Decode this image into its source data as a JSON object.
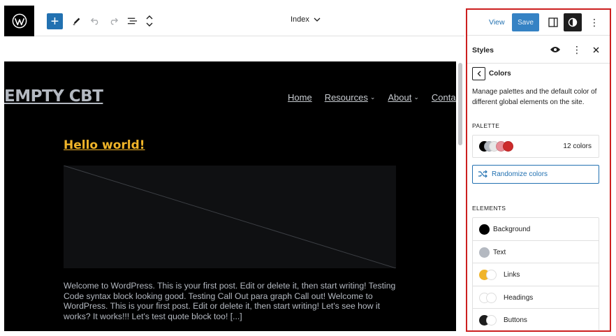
{
  "toolbar": {
    "document_title": "Index"
  },
  "site": {
    "title": "EMPTY CBT",
    "nav": [
      {
        "label": "Home",
        "has_submenu": false
      },
      {
        "label": "Resources",
        "has_submenu": true
      },
      {
        "label": "About",
        "has_submenu": true
      },
      {
        "label": "Contact",
        "has_submenu": false
      }
    ]
  },
  "post": {
    "title": "Hello world!",
    "excerpt": "Welcome to WordPress. This is your first post. Edit or delete it, then start writing! Testing Code syntax block looking good. Testing Call Out para graph Call out! Welcome to WordPress. This is your first post. Edit or delete it, then start writing! Let's see how it works? It works!!! Let's test quote block too! [...]"
  },
  "header_actions": {
    "view_label": "View",
    "save_label": "Save"
  },
  "styles_panel": {
    "title": "Styles",
    "colors": {
      "title": "Colors",
      "description": "Manage palettes and the default color of different global elements on the site.",
      "palette_label": "PALETTE",
      "palette_count": "12 colors",
      "palette_swatches": [
        "#000000",
        "#b4b9c1",
        "#e8e8e8",
        "#e88d97",
        "#cc2b2b"
      ],
      "randomize_label": "Randomize colors",
      "elements_label": "ELEMENTS",
      "elements": [
        {
          "label": "Background",
          "color": "#000000",
          "style": "solid"
        },
        {
          "label": "Text",
          "color": "#b4b9c1",
          "style": "solid"
        },
        {
          "label": "Links",
          "color": "#f0b429",
          "style": "split"
        },
        {
          "label": "Headings",
          "color": "#ffffff",
          "style": "empty"
        },
        {
          "label": "Buttons",
          "color": "#1e1e1e",
          "style": "split"
        }
      ]
    }
  },
  "colors": {
    "accent": "#2271b1",
    "highlight_border": "#cc1f1f",
    "canvas_bg": "#000000",
    "post_title": "#f0b429"
  }
}
